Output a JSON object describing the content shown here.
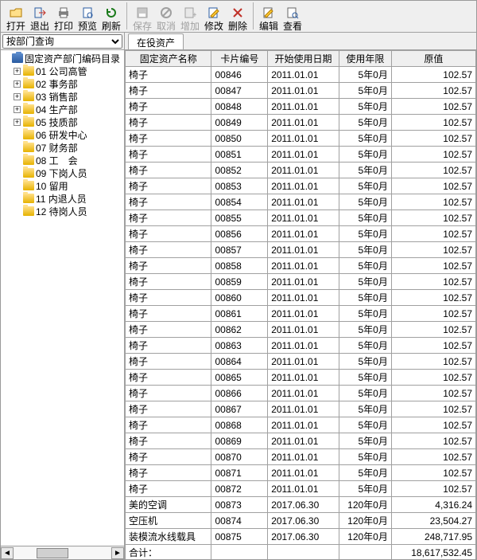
{
  "toolbar": {
    "open": "打开",
    "exit": "退出",
    "print": "打印",
    "preview": "预览",
    "refresh": "刷新",
    "save": "保存",
    "cancel": "取消",
    "add": "增加",
    "modify": "修改",
    "delete": "删除",
    "edit": "编辑",
    "view": "查看"
  },
  "combo": {
    "value": "按部门查询"
  },
  "tree": {
    "root": "固定资产部门编码目录",
    "items": [
      {
        "code": "01",
        "label": "公司高管",
        "expandable": true,
        "sign": "+"
      },
      {
        "code": "02",
        "label": "事务部",
        "expandable": true,
        "sign": "+"
      },
      {
        "code": "03",
        "label": "销售部",
        "expandable": true,
        "sign": "+"
      },
      {
        "code": "04",
        "label": "生产部",
        "expandable": true,
        "sign": "+"
      },
      {
        "code": "05",
        "label": "技质部",
        "expandable": true,
        "sign": "+"
      },
      {
        "code": "06",
        "label": "研发中心",
        "expandable": false,
        "sign": ""
      },
      {
        "code": "07",
        "label": "财务部",
        "expandable": false,
        "sign": ""
      },
      {
        "code": "08",
        "label": "工　会",
        "expandable": false,
        "sign": ""
      },
      {
        "code": "09",
        "label": "下岗人员",
        "expandable": false,
        "sign": ""
      },
      {
        "code": "10",
        "label": "留用",
        "expandable": false,
        "sign": ""
      },
      {
        "code": "11",
        "label": "内退人员",
        "expandable": false,
        "sign": ""
      },
      {
        "code": "12",
        "label": "待岗人员",
        "expandable": false,
        "sign": ""
      }
    ]
  },
  "tab": {
    "active": "在役资产"
  },
  "grid": {
    "headers": {
      "name": "固定资产名称",
      "card": "卡片编号",
      "date": "开始使用日期",
      "life": "使用年限",
      "value": "原值"
    },
    "rows": [
      {
        "name": "椅子",
        "card": "00846",
        "date": "2011.01.01",
        "life": "5年0月",
        "value": "102.57"
      },
      {
        "name": "椅子",
        "card": "00847",
        "date": "2011.01.01",
        "life": "5年0月",
        "value": "102.57"
      },
      {
        "name": "椅子",
        "card": "00848",
        "date": "2011.01.01",
        "life": "5年0月",
        "value": "102.57"
      },
      {
        "name": "椅子",
        "card": "00849",
        "date": "2011.01.01",
        "life": "5年0月",
        "value": "102.57"
      },
      {
        "name": "椅子",
        "card": "00850",
        "date": "2011.01.01",
        "life": "5年0月",
        "value": "102.57"
      },
      {
        "name": "椅子",
        "card": "00851",
        "date": "2011.01.01",
        "life": "5年0月",
        "value": "102.57"
      },
      {
        "name": "椅子",
        "card": "00852",
        "date": "2011.01.01",
        "life": "5年0月",
        "value": "102.57"
      },
      {
        "name": "椅子",
        "card": "00853",
        "date": "2011.01.01",
        "life": "5年0月",
        "value": "102.57"
      },
      {
        "name": "椅子",
        "card": "00854",
        "date": "2011.01.01",
        "life": "5年0月",
        "value": "102.57"
      },
      {
        "name": "椅子",
        "card": "00855",
        "date": "2011.01.01",
        "life": "5年0月",
        "value": "102.57"
      },
      {
        "name": "椅子",
        "card": "00856",
        "date": "2011.01.01",
        "life": "5年0月",
        "value": "102.57"
      },
      {
        "name": "椅子",
        "card": "00857",
        "date": "2011.01.01",
        "life": "5年0月",
        "value": "102.57"
      },
      {
        "name": "椅子",
        "card": "00858",
        "date": "2011.01.01",
        "life": "5年0月",
        "value": "102.57"
      },
      {
        "name": "椅子",
        "card": "00859",
        "date": "2011.01.01",
        "life": "5年0月",
        "value": "102.57"
      },
      {
        "name": "椅子",
        "card": "00860",
        "date": "2011.01.01",
        "life": "5年0月",
        "value": "102.57"
      },
      {
        "name": "椅子",
        "card": "00861",
        "date": "2011.01.01",
        "life": "5年0月",
        "value": "102.57"
      },
      {
        "name": "椅子",
        "card": "00862",
        "date": "2011.01.01",
        "life": "5年0月",
        "value": "102.57"
      },
      {
        "name": "椅子",
        "card": "00863",
        "date": "2011.01.01",
        "life": "5年0月",
        "value": "102.57"
      },
      {
        "name": "椅子",
        "card": "00864",
        "date": "2011.01.01",
        "life": "5年0月",
        "value": "102.57"
      },
      {
        "name": "椅子",
        "card": "00865",
        "date": "2011.01.01",
        "life": "5年0月",
        "value": "102.57"
      },
      {
        "name": "椅子",
        "card": "00866",
        "date": "2011.01.01",
        "life": "5年0月",
        "value": "102.57"
      },
      {
        "name": "椅子",
        "card": "00867",
        "date": "2011.01.01",
        "life": "5年0月",
        "value": "102.57"
      },
      {
        "name": "椅子",
        "card": "00868",
        "date": "2011.01.01",
        "life": "5年0月",
        "value": "102.57"
      },
      {
        "name": "椅子",
        "card": "00869",
        "date": "2011.01.01",
        "life": "5年0月",
        "value": "102.57"
      },
      {
        "name": "椅子",
        "card": "00870",
        "date": "2011.01.01",
        "life": "5年0月",
        "value": "102.57"
      },
      {
        "name": "椅子",
        "card": "00871",
        "date": "2011.01.01",
        "life": "5年0月",
        "value": "102.57"
      },
      {
        "name": "椅子",
        "card": "00872",
        "date": "2011.01.01",
        "life": "5年0月",
        "value": "102.57"
      },
      {
        "name": "美的空调",
        "card": "00873",
        "date": "2017.06.30",
        "life": "120年0月",
        "value": "4,316.24"
      },
      {
        "name": "空压机",
        "card": "00874",
        "date": "2017.06.30",
        "life": "120年0月",
        "value": "23,504.27"
      },
      {
        "name": "装模流水线载具",
        "card": "00875",
        "date": "2017.06.30",
        "life": "120年0月",
        "value": "248,717.95"
      }
    ],
    "total_label": "合计：",
    "total_value": "18,617,532.45"
  }
}
